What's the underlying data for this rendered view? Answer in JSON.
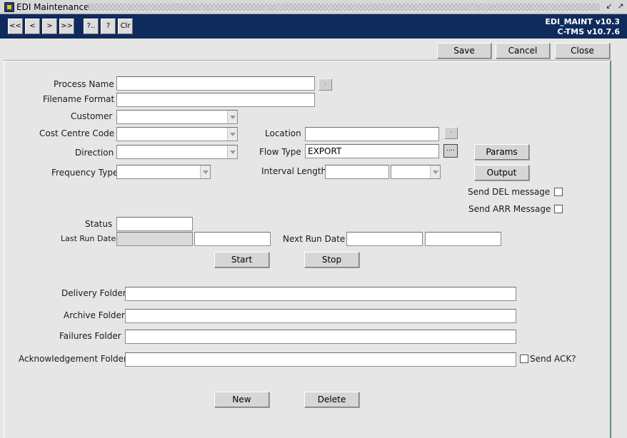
{
  "window": {
    "title": "EDI Maintenance",
    "app_icon": "app-window-icon",
    "minimize_glyph": "↙",
    "maximize_glyph": "↗"
  },
  "toolbar": {
    "nav": {
      "first": "<<",
      "prev": "<",
      "next": ">",
      "last": ">>",
      "query": "?..",
      "help": "?",
      "clear": "Clr"
    },
    "version_line1": "EDI_MAINT v10.3",
    "version_line2": "C-TMS v10.7.6"
  },
  "actions": {
    "save": "Save",
    "cancel": "Cancel",
    "close": "Close"
  },
  "form": {
    "process_name": {
      "label": "Process Name",
      "value": ""
    },
    "filename_format": {
      "label": "Filename Format",
      "value": ""
    },
    "customer": {
      "label": "Customer",
      "value": ""
    },
    "cost_centre_code": {
      "label": "Cost Centre Code",
      "value": ""
    },
    "location": {
      "label": "Location",
      "value": ""
    },
    "direction": {
      "label": "Direction",
      "value": ""
    },
    "flow_type": {
      "label": "Flow Type",
      "value": "EXPORT",
      "lov_glyph": "...."
    },
    "params_button": "Params",
    "frequency_type": {
      "label": "Frequency Type",
      "value": ""
    },
    "interval_length": {
      "label": "Interval Length",
      "value": "",
      "unit": ""
    },
    "output_button": "Output",
    "send_del": {
      "label": "Send DEL message",
      "checked": false
    },
    "send_arr": {
      "label": "Send ARR Message",
      "checked": false
    },
    "status": {
      "label": "Status",
      "value": ""
    },
    "last_run_date": {
      "label": "Last Run Date",
      "date": "",
      "time": ""
    },
    "next_run_date": {
      "label": "Next Run Date",
      "date": "",
      "time": ""
    },
    "start_button": "Start",
    "stop_button": "Stop",
    "delivery_folder": {
      "label": "Delivery Folder",
      "value": ""
    },
    "archive_folder": {
      "label": "Archive Folder",
      "value": ""
    },
    "failures_folder": {
      "label": "Failures Folder",
      "value": ""
    },
    "ack_folder": {
      "label": "Acknowledgement Folder",
      "value": ""
    },
    "send_ack": {
      "label": "Send ACK?",
      "checked": false
    },
    "new_button": "New",
    "delete_button": "Delete"
  },
  "colors": {
    "toolbar_bg": "#0f2a5c",
    "panel_border": "#5a8f87",
    "window_bg": "#e6e6e6"
  }
}
